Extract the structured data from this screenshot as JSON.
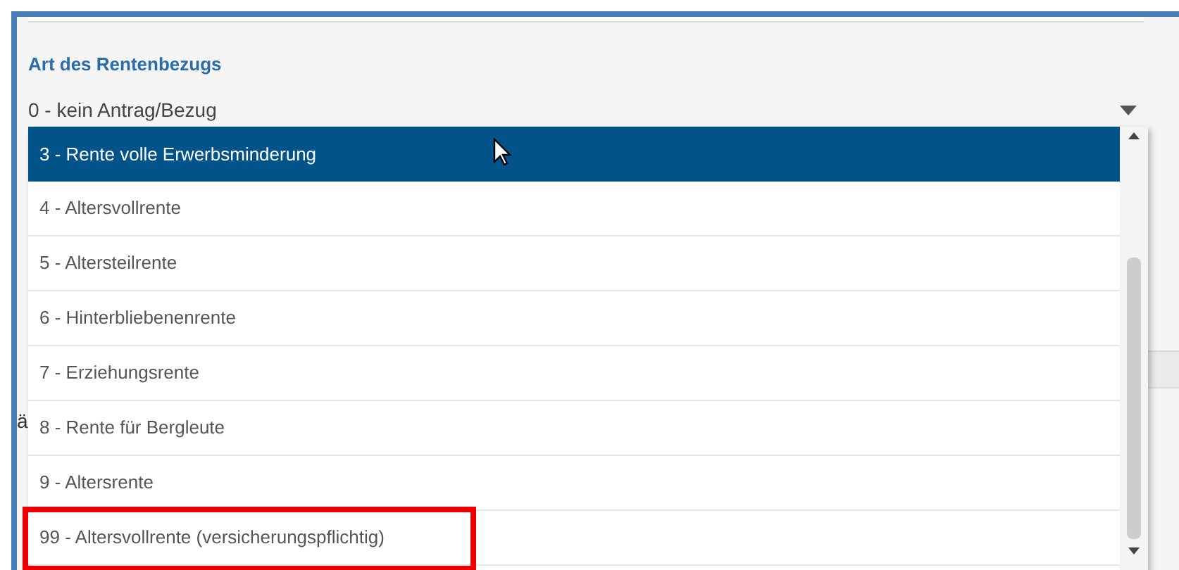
{
  "field": {
    "label": "Art des Rentenbezugs",
    "value": "0 - kein Antrag/Bezug"
  },
  "background_fragment": "ä",
  "options": [
    {
      "label": "3 - Rente volle Erwerbsminderung",
      "selected": true,
      "highlighted": false
    },
    {
      "label": "4 - Altersvollrente",
      "selected": false,
      "highlighted": false
    },
    {
      "label": "5 - Altersteilrente",
      "selected": false,
      "highlighted": false
    },
    {
      "label": "6 - Hinterbliebenenrente",
      "selected": false,
      "highlighted": false
    },
    {
      "label": "7 - Erziehungsrente",
      "selected": false,
      "highlighted": false
    },
    {
      "label": "8 - Rente für Bergleute",
      "selected": false,
      "highlighted": false
    },
    {
      "label": "9 - Altersrente",
      "selected": false,
      "highlighted": false
    },
    {
      "label": "99 - Altersvollrente (versicherungspflichtig)",
      "selected": false,
      "highlighted": true
    }
  ]
}
